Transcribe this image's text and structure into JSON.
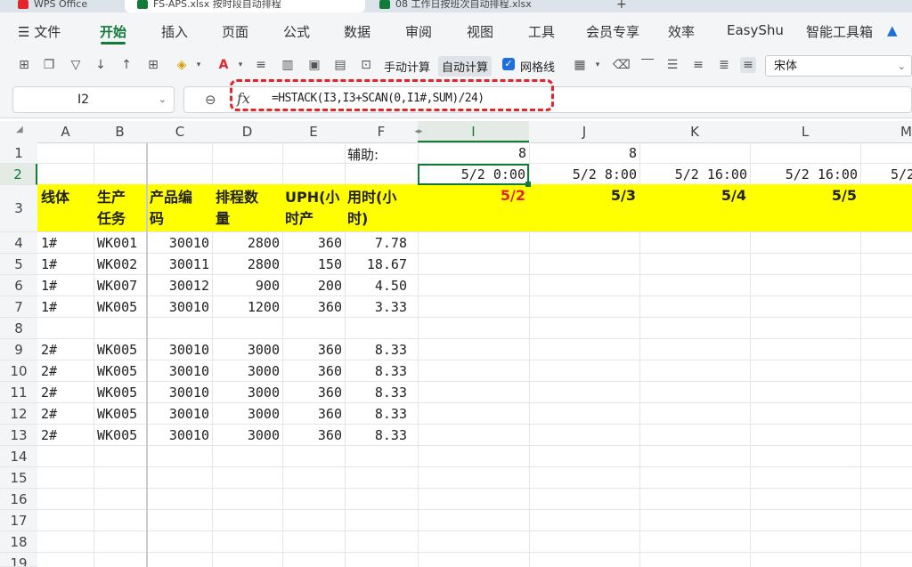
{
  "tabs": [
    {
      "label": "WPS Office",
      "active": false,
      "color": "#e0252c"
    },
    {
      "label": "FS-APS.xlsx 按时段自动排程",
      "active": true,
      "color": "#137a3a"
    },
    {
      "label": "08 工作日按班次自动排程.xlsx",
      "active": false,
      "color": "#137a3a"
    }
  ],
  "menu": {
    "file": "文件",
    "items": [
      "开始",
      "插入",
      "页面",
      "公式",
      "数据",
      "审阅",
      "视图",
      "工具",
      "会员专享",
      "效率",
      "EasyShu",
      "智能工具箱"
    ],
    "active": "开始"
  },
  "toolbar": {
    "manual_calc": "手动计算",
    "auto_calc": "自动计算",
    "gridlines": "网格线",
    "font": "宋体"
  },
  "formula_bar": {
    "name_box": "I2",
    "fx": "fx",
    "formula": "=HSTACK(I3,I3+SCAN(0,I1#,SUM)/24)"
  },
  "columns": [
    "A",
    "B",
    "C",
    "D",
    "E",
    "F",
    "I",
    "J",
    "K",
    "L"
  ],
  "selected_column": "I",
  "selected_row": "2",
  "row_numbers": [
    "1",
    "2",
    "3",
    "4",
    "5",
    "6",
    "7",
    "8",
    "9",
    "10",
    "11",
    "12",
    "13",
    "14",
    "15",
    "16",
    "17",
    "18",
    "19"
  ],
  "row1": {
    "label": "辅助:",
    "I": "8",
    "J": "8"
  },
  "row2": {
    "I": "5/2 0:00",
    "J": "5/2 8:00",
    "K": "5/2 16:00",
    "L": "5/2 16:00"
  },
  "headers": {
    "A": [
      "线体"
    ],
    "B": [
      "生产",
      "任务"
    ],
    "C": [
      "产品编",
      "码"
    ],
    "D": [
      "排程数",
      "量"
    ],
    "E": [
      "UPH(小",
      "时产"
    ],
    "F": [
      "用时(小",
      "时)"
    ]
  },
  "dates": {
    "I": "5/2",
    "J": "5/3",
    "K": "5/4",
    "L": "5/5"
  },
  "rows": [
    {
      "row": "4",
      "line": "1#",
      "task": "WK001",
      "code": "30010",
      "qty": "2800",
      "uph": "360",
      "hours": "7.78"
    },
    {
      "row": "5",
      "line": "1#",
      "task": "WK002",
      "code": "30011",
      "qty": "2800",
      "uph": "150",
      "hours": "18.67"
    },
    {
      "row": "6",
      "line": "1#",
      "task": "WK007",
      "code": "30012",
      "qty": "900",
      "uph": "200",
      "hours": "4.50"
    },
    {
      "row": "7",
      "line": "1#",
      "task": "WK005",
      "code": "30010",
      "qty": "1200",
      "uph": "360",
      "hours": "3.33"
    },
    {
      "row": "9",
      "line": "2#",
      "task": "WK005",
      "code": "30010",
      "qty": "3000",
      "uph": "360",
      "hours": "8.33"
    },
    {
      "row": "10",
      "line": "2#",
      "task": "WK005",
      "code": "30010",
      "qty": "3000",
      "uph": "360",
      "hours": "8.33"
    },
    {
      "row": "11",
      "line": "2#",
      "task": "WK005",
      "code": "30010",
      "qty": "3000",
      "uph": "360",
      "hours": "8.33"
    },
    {
      "row": "12",
      "line": "2#",
      "task": "WK005",
      "code": "30010",
      "qty": "3000",
      "uph": "360",
      "hours": "8.33"
    },
    {
      "row": "13",
      "line": "2#",
      "task": "WK005",
      "code": "30010",
      "qty": "3000",
      "uph": "360",
      "hours": "8.33"
    }
  ],
  "colors": {
    "accent": "#137a3a",
    "highlight": "#ffff00",
    "alert": "#e0252c"
  }
}
